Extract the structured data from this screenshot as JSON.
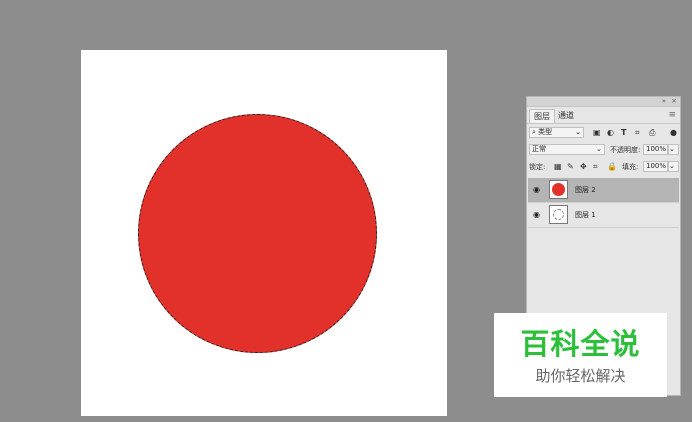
{
  "canvas": {
    "background": "#ffffff",
    "shape_color": "#e2312b",
    "selection": "marquee-circle"
  },
  "layers_panel": {
    "collapse_label": "»",
    "close_label": "×",
    "tabs": [
      "图层",
      "通道"
    ],
    "active_tab": "图层",
    "menu_icon": "panel-menu-icon",
    "filter": {
      "kind_label": "类型",
      "icons": [
        "image-filter-icon",
        "adjustment-filter-icon",
        "type-filter-icon",
        "shape-filter-icon",
        "smart-object-filter-icon"
      ]
    },
    "blend_mode": "正常",
    "opacity": {
      "label": "不透明度:",
      "value": "100%"
    },
    "lock": {
      "label": "锁定:",
      "icons": [
        "lock-transparent-icon",
        "lock-image-icon",
        "lock-position-icon",
        "lock-artboard-icon",
        "lock-all-icon"
      ]
    },
    "fill": {
      "label": "填充:",
      "value": "100%"
    },
    "layers": [
      {
        "name": "图层 2",
        "selected": true,
        "thumbnail": "red-circle"
      },
      {
        "name": "图层 1",
        "selected": false,
        "thumbnail": "empty-circle"
      }
    ]
  },
  "watermark": {
    "title": "百科全说",
    "subtitle": "助你轻松解决",
    "title_color": "#2bbf3a"
  }
}
